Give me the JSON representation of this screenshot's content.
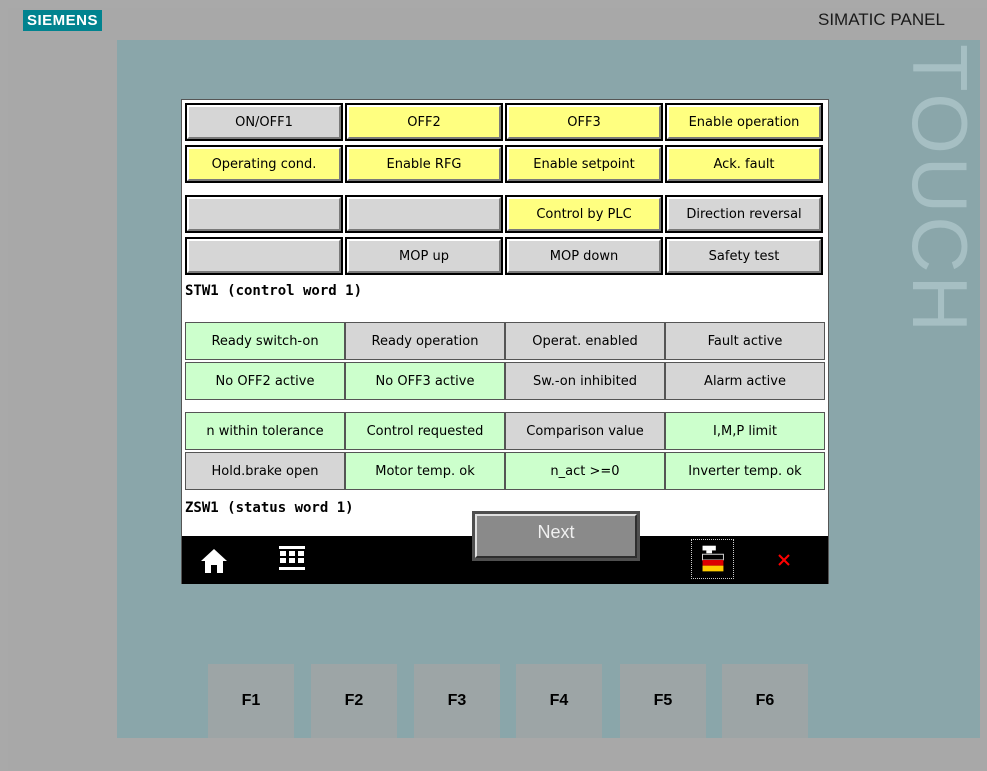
{
  "device": {
    "brand": "SIEMENS",
    "panel_name": "SIMATIC PANEL",
    "touch_label": "TOUCH"
  },
  "control_word": {
    "label": "STW1 (control word 1)",
    "buttons": [
      {
        "label": "ON/OFF1",
        "state": "off"
      },
      {
        "label": "OFF2",
        "state": "on"
      },
      {
        "label": "OFF3",
        "state": "on"
      },
      {
        "label": "Enable operation",
        "state": "on"
      },
      {
        "label": "Operating cond.",
        "state": "on"
      },
      {
        "label": "Enable RFG",
        "state": "on"
      },
      {
        "label": "Enable setpoint",
        "state": "on"
      },
      {
        "label": "Ack. fault",
        "state": "on"
      },
      {
        "label": "",
        "state": "off"
      },
      {
        "label": "",
        "state": "off"
      },
      {
        "label": "Control by PLC",
        "state": "on"
      },
      {
        "label": "Direction reversal",
        "state": "off"
      },
      {
        "label": "",
        "state": "off"
      },
      {
        "label": "MOP up",
        "state": "off"
      },
      {
        "label": "MOP down",
        "state": "off"
      },
      {
        "label": "Safety test",
        "state": "off"
      }
    ]
  },
  "status_word": {
    "label": "ZSW1 (status word 1)",
    "items": [
      {
        "label": "Ready switch-on",
        "state": "on"
      },
      {
        "label": "Ready operation",
        "state": "off"
      },
      {
        "label": "Operat. enabled",
        "state": "off"
      },
      {
        "label": "Fault active",
        "state": "off"
      },
      {
        "label": "No OFF2 active",
        "state": "on"
      },
      {
        "label": "No OFF3 active",
        "state": "on"
      },
      {
        "label": "Sw.-on inhibited",
        "state": "off"
      },
      {
        "label": "Alarm active",
        "state": "off"
      },
      {
        "label": "n within tolerance",
        "state": "on"
      },
      {
        "label": "Control requested",
        "state": "on"
      },
      {
        "label": "Comparison value",
        "state": "off"
      },
      {
        "label": "I,M,P limit",
        "state": "on"
      },
      {
        "label": "Hold.brake open",
        "state": "off"
      },
      {
        "label": "Motor temp. ok",
        "state": "on"
      },
      {
        "label": "n_act >=0",
        "state": "on"
      },
      {
        "label": "Inverter temp. ok",
        "state": "on"
      }
    ]
  },
  "next_button": {
    "label": "Next"
  },
  "nav": {
    "home_icon": "home-icon",
    "grid_icon": "grid-icon",
    "language_icon": "language-flag-icon",
    "close_icon": "close-icon"
  },
  "function_keys": [
    "F1",
    "F2",
    "F3",
    "F4",
    "F5",
    "F6"
  ],
  "colors": {
    "active_yellow": "#ffff80",
    "active_green": "#ccffcc",
    "inactive_grey": "#d6d6d6",
    "close_red": "#ff0000"
  }
}
